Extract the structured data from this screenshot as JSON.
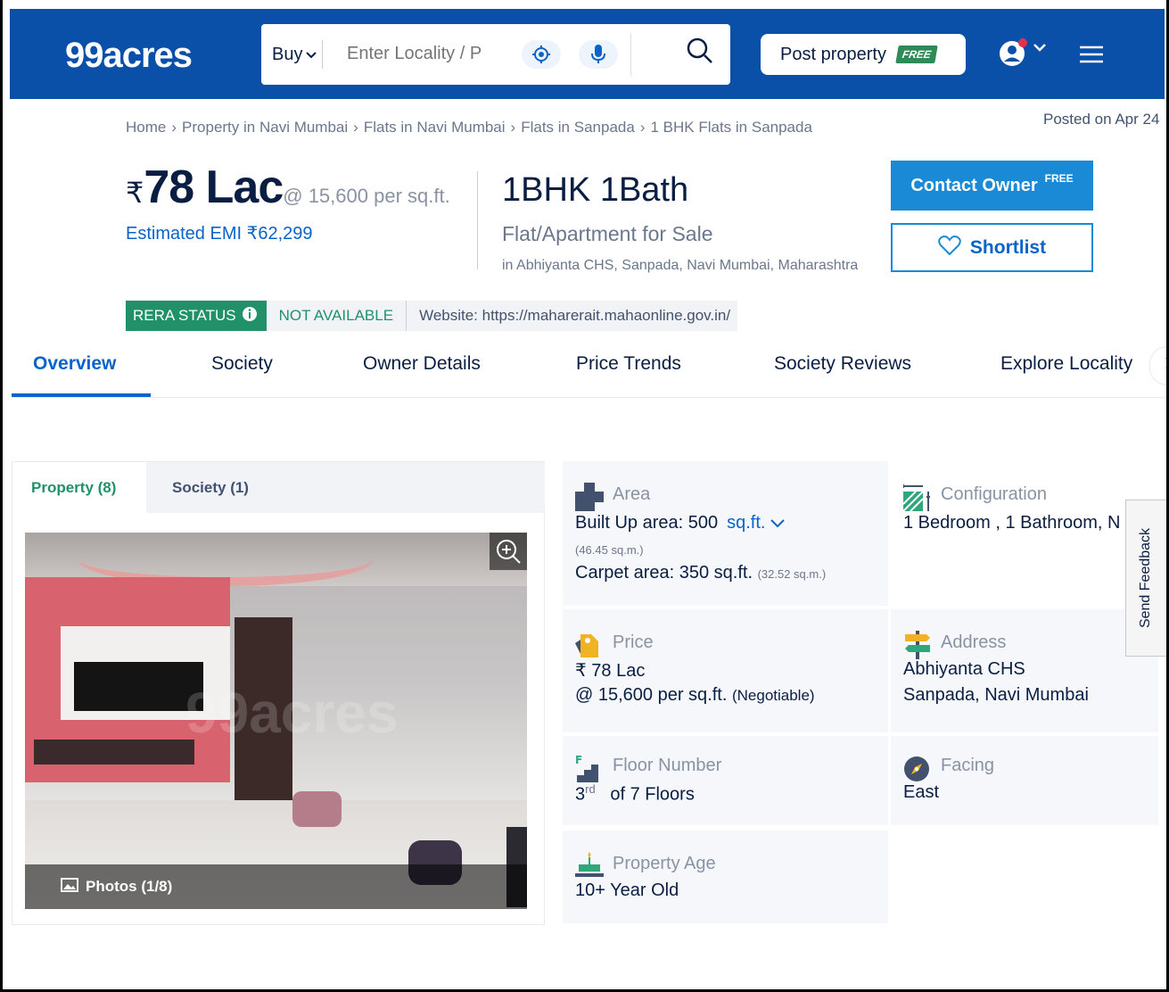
{
  "header": {
    "logo": "99acres",
    "search": {
      "buy_label": "Buy",
      "placeholder": "Enter Locality / P"
    },
    "post_property_label": "Post property",
    "post_property_badge": "FREE"
  },
  "breadcrumb": {
    "items": [
      "Home",
      "Property in Navi Mumbai",
      "Flats in Navi Mumbai",
      "Flats in Sanpada",
      "1 BHK Flats in Sanpada"
    ],
    "separator": "›",
    "posted": "Posted on Apr 24"
  },
  "listing": {
    "currency_symbol": "₹",
    "price": "78 Lac",
    "price_per_sqft": "@ 15,600 per sq.ft.",
    "emi": "Estimated EMI ₹62,299",
    "title": "1BHK 1Bath",
    "type": "Flat/Apartment for Sale",
    "address": "in Abhiyanta CHS, Sanpada, Navi Mumbai, Maharashtra",
    "contact_label": "Contact Owner",
    "contact_badge": "FREE",
    "shortlist_label": "Shortlist"
  },
  "rera": {
    "label": "RERA STATUS",
    "status": "NOT AVAILABLE",
    "website": "Website: https://maharerait.mahaonline.gov.in/"
  },
  "tabs": [
    "Overview",
    "Society",
    "Owner Details",
    "Price Trends",
    "Society Reviews",
    "Explore Locality"
  ],
  "gallery": {
    "tabs": [
      "Property (8)",
      "Society (1)"
    ],
    "photos_label": "Photos (1/8)",
    "watermark": "99acres"
  },
  "details": {
    "area": {
      "title": "Area",
      "built_up": "Built Up area: 500",
      "unit": "sq.ft.",
      "built_up_sqm": "(46.45 sq.m.)",
      "carpet": "Carpet area: 350 sq.ft.",
      "carpet_sqm": "(32.52 sq.m.)"
    },
    "configuration": {
      "title": "Configuration",
      "value": "1 Bedroom , 1 Bathroom, N"
    },
    "price": {
      "title": "Price",
      "value": "₹ 78 Lac",
      "per_sqft": "@ 15,600 per sq.ft.",
      "negotiable": "(Negotiable)"
    },
    "address": {
      "title": "Address",
      "line1": "Abhiyanta CHS",
      "line2": "Sanpada, Navi Mumbai"
    },
    "floor": {
      "title": "Floor Number",
      "floor": "3",
      "suffix": "rd",
      "total": "of 7 Floors"
    },
    "facing": {
      "title": "Facing",
      "value": "East"
    },
    "age": {
      "title": "Property Age",
      "value": "10+ Year Old"
    }
  },
  "feedback_label": "Send Feedback",
  "colors": {
    "header_blue": "#0a4fa8",
    "link_blue": "#0a63c9",
    "green": "#21916a",
    "button_blue": "#1a8ad6"
  }
}
